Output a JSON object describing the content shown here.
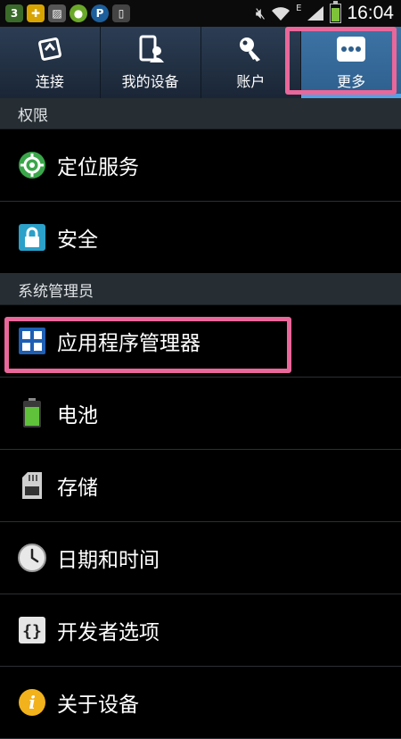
{
  "status_bar": {
    "time": "16:04",
    "network_badge": "E",
    "icons": [
      "notification-3-icon",
      "app-icon",
      "gallery-icon",
      "app-icon-2",
      "browser-icon",
      "screenshot-icon",
      "mute-icon",
      "wifi-icon",
      "signal-icon",
      "battery-icon"
    ]
  },
  "tabs": [
    {
      "label": "连接",
      "icon": "connections-icon"
    },
    {
      "label": "我的设备",
      "icon": "device-icon"
    },
    {
      "label": "账户",
      "icon": "key-icon"
    },
    {
      "label": "更多",
      "icon": "more-icon",
      "active": true
    }
  ],
  "sections": [
    {
      "title": "权限",
      "items": [
        {
          "label": "定位服务",
          "icon": "location-icon"
        },
        {
          "label": "安全",
          "icon": "lock-icon"
        }
      ]
    },
    {
      "title": "系统管理员",
      "items": [
        {
          "label": "应用程序管理器",
          "icon": "app-manager-icon"
        },
        {
          "label": "电池",
          "icon": "battery-icon"
        },
        {
          "label": "存储",
          "icon": "sd-card-icon"
        },
        {
          "label": "日期和时间",
          "icon": "clock-icon"
        },
        {
          "label": "开发者选项",
          "icon": "braces-icon"
        },
        {
          "label": "关于设备",
          "icon": "info-icon"
        }
      ]
    }
  ],
  "colors": {
    "accent": "#4fa3e6",
    "highlight": "#e9679a",
    "tab_bg": "#24344a",
    "section_bg": "#262d33"
  }
}
